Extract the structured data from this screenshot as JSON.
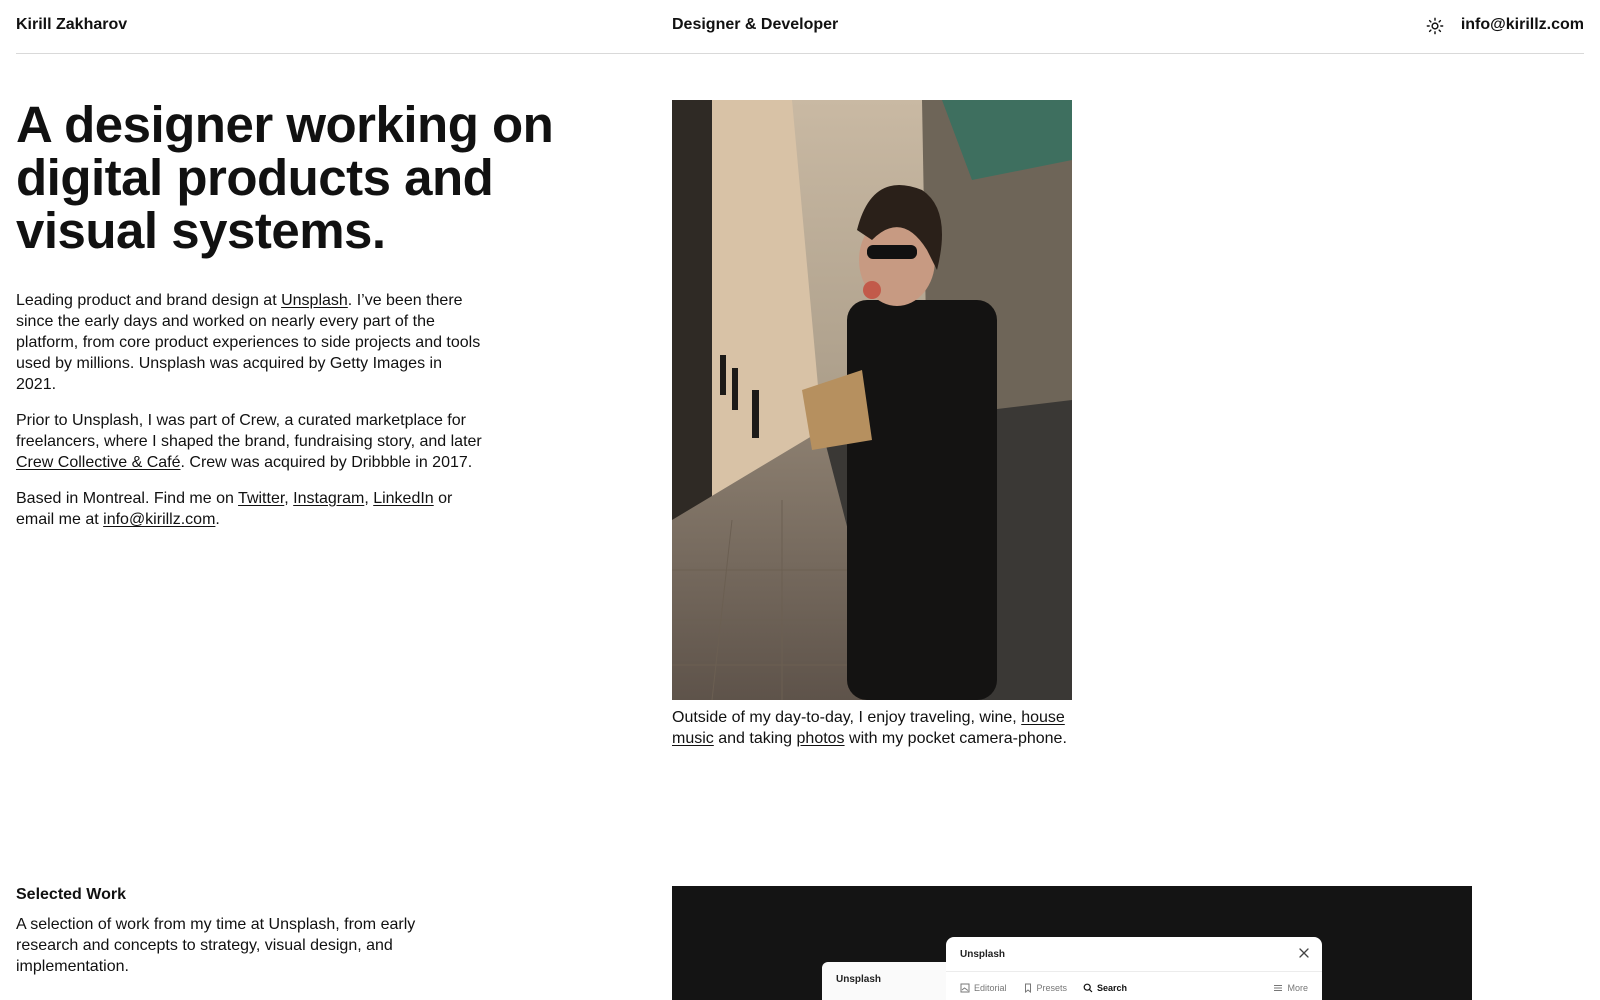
{
  "header": {
    "name": "Kirill Zakharov",
    "role": "Designer & Developer",
    "theme_icon": "sun-icon",
    "email": "info@kirillz.com"
  },
  "headline": "A designer working on digital products and visual systems.",
  "bio": {
    "p1_before": "Leading product and brand design at ",
    "p1_link": "Unsplash",
    "p1_after": ". I’ve been there since the early days and worked on nearly every part of the platform, from core product experiences to side projects and tools used by millions. Unsplash was acquired by Getty Images in 2021.",
    "p2_before": "Prior to Unsplash, I was part of Crew, a curated marketplace for freelancers, where I shaped the brand, fundraising story, and later ",
    "p2_link": "Crew Collective & Café",
    "p2_after": ". Crew was acquired by Dribbble in 2017.",
    "p3_before": "Based in Montreal. Find me on ",
    "p3_twitter": "Twitter",
    "p3_sep1": ", ",
    "p3_instagram": "Instagram",
    "p3_sep2": ", ",
    "p3_linkedin": "LinkedIn",
    "p3_mid": " or email me at ",
    "p3_email": "info@kirillz.com",
    "p3_end": "."
  },
  "caption": {
    "before": "Outside of my day-to-day, I enjoy traveling, wine, ",
    "link1": "house music",
    "mid": " and taking ",
    "link2": "photos",
    "after": " with my pocket camera-phone."
  },
  "work": {
    "title": "Selected Work",
    "description": "A selection of work from my time at Unsplash, from early research and concepts to strategy, visual design, and implementation.",
    "preview": {
      "back_window_title": "Unsplash",
      "front_window_title": "Unsplash",
      "tabs": [
        "Editorial",
        "Presets",
        "Search",
        "More"
      ],
      "active_tab": "Search"
    }
  }
}
